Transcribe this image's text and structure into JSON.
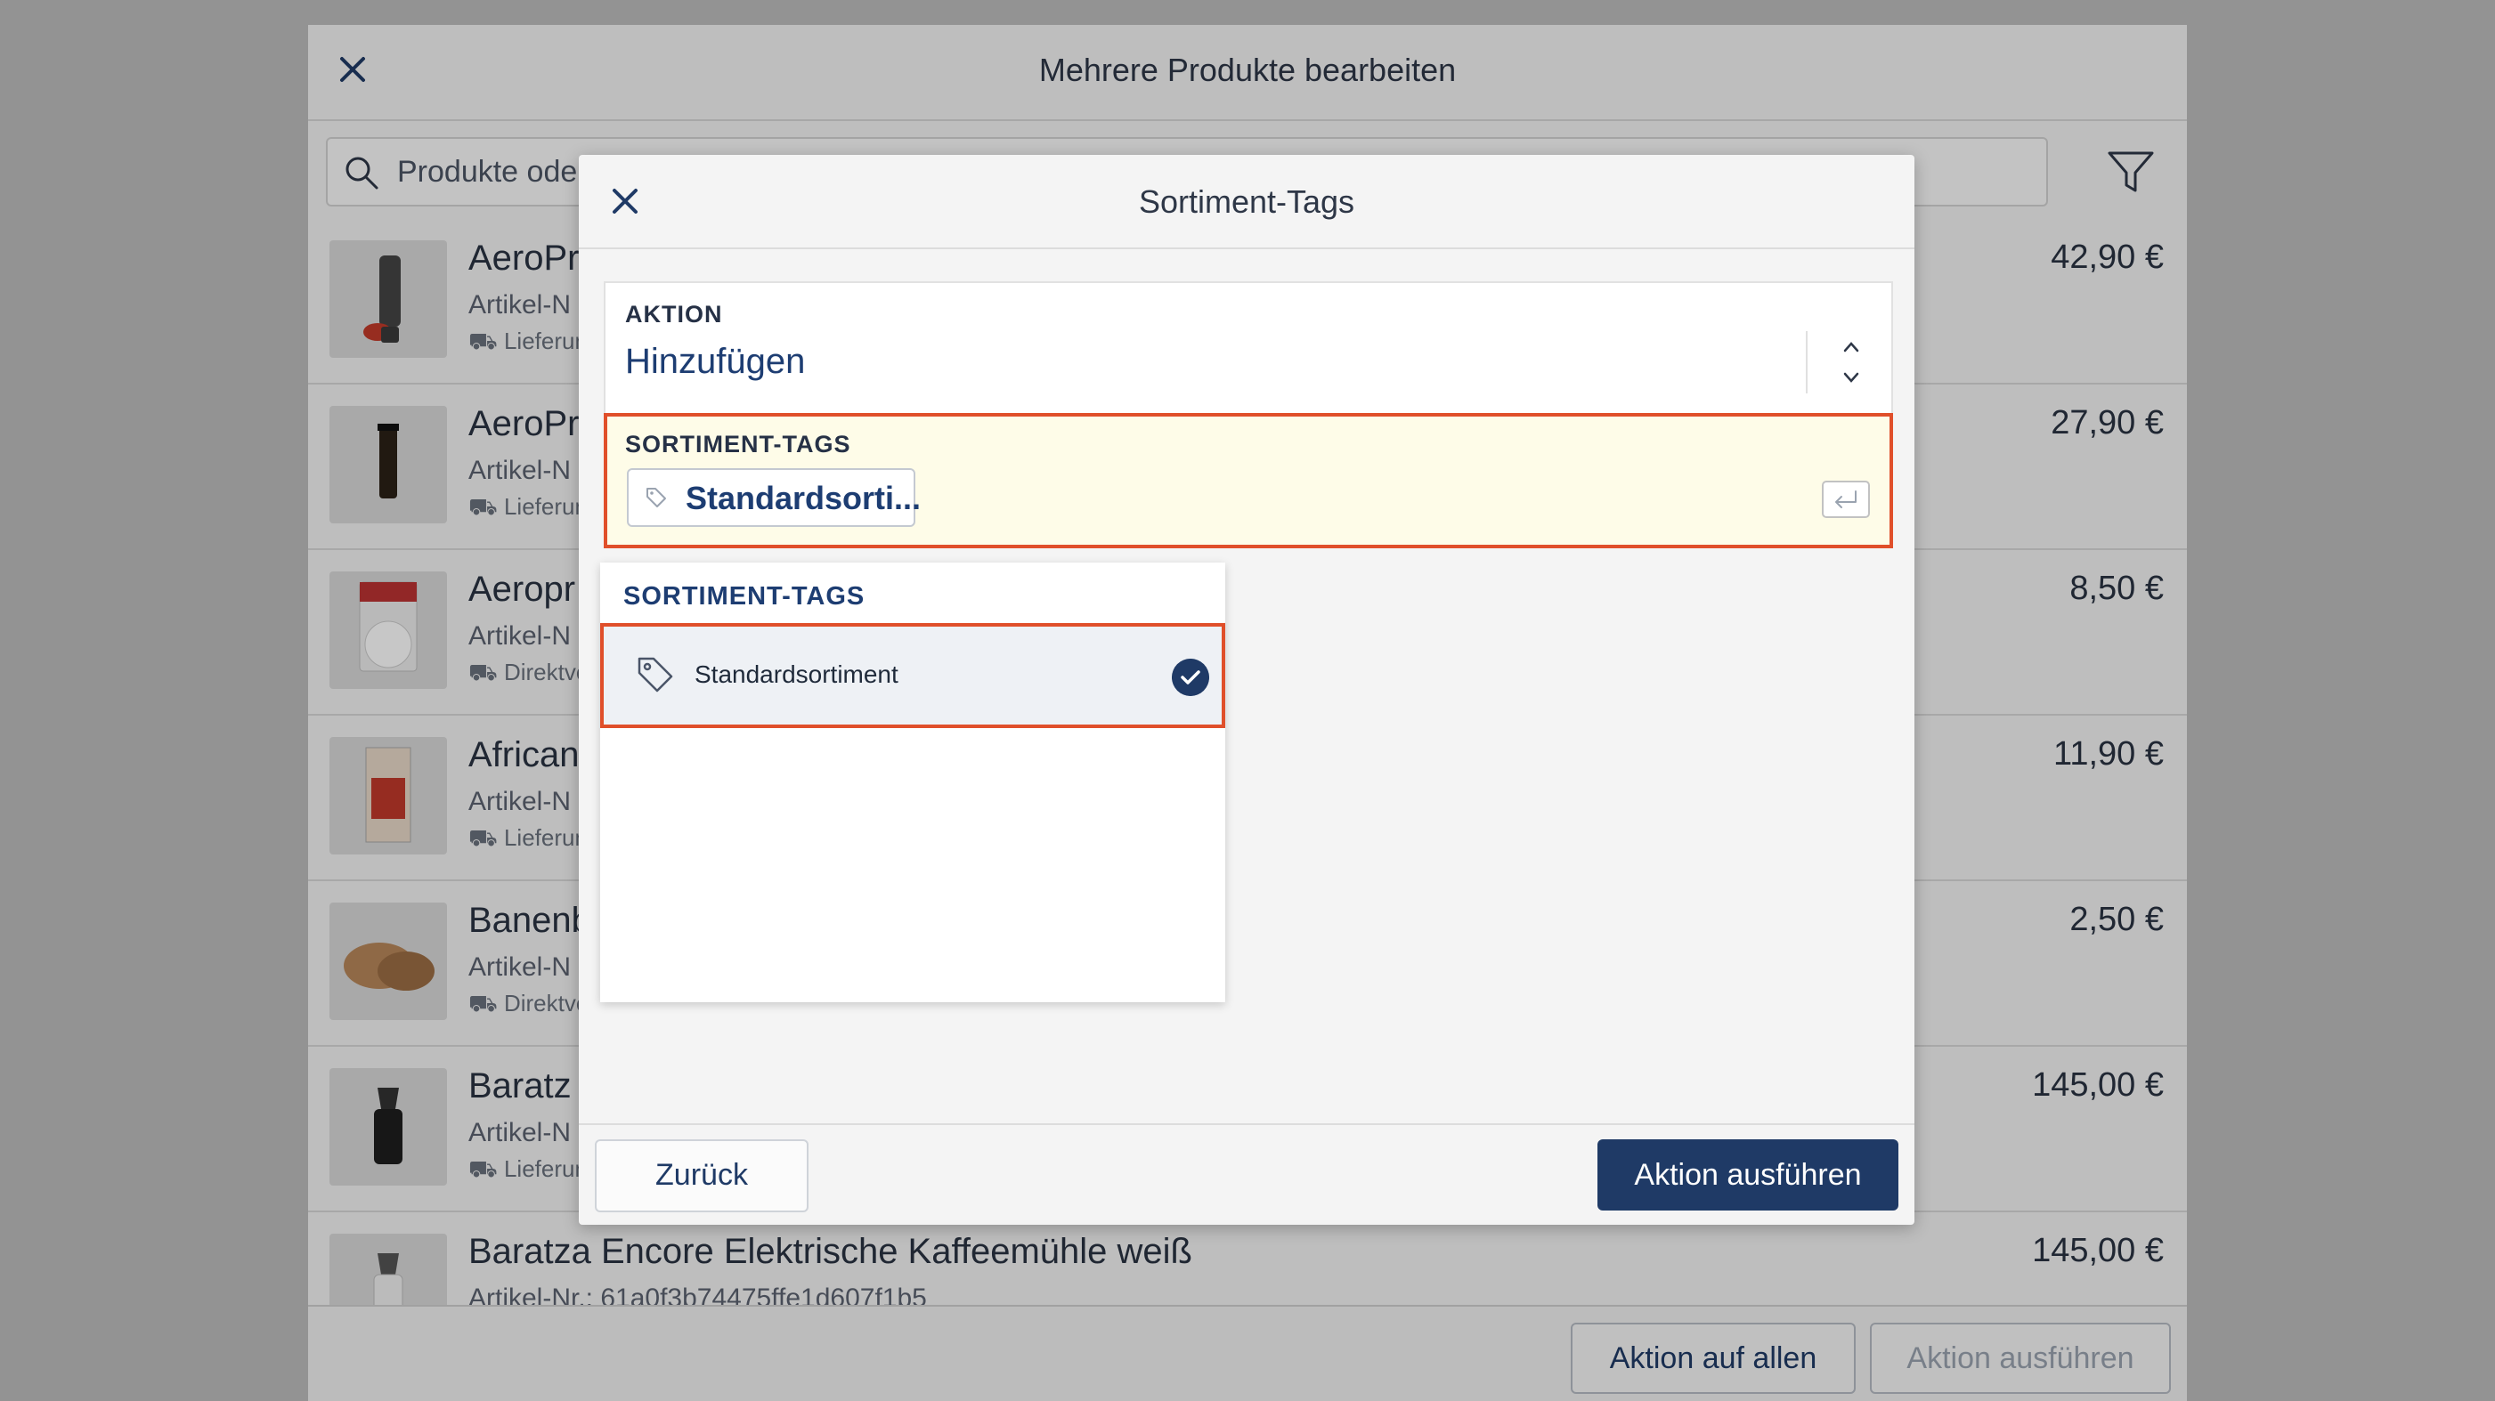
{
  "background": {
    "title": "Mehrere Produkte bearbeiten",
    "search_placeholder": "Produkte oder",
    "products": [
      {
        "name": "AeroPr",
        "sku": "Artikel-N",
        "meta": "Lieferun",
        "price": "42,90 €"
      },
      {
        "name": "AeroPr",
        "sku": "Artikel-N",
        "meta": "Lieferun",
        "price": "27,90 €"
      },
      {
        "name": "Aeropr",
        "sku": "Artikel-N",
        "meta": "Direktve",
        "price": "8,50 €"
      },
      {
        "name": "African",
        "sku": "Artikel-N",
        "meta": "Lieferun",
        "price": "11,90 €"
      },
      {
        "name": "Banenb",
        "sku": "Artikel-N",
        "meta": "Direktve",
        "price": "2,50 €"
      },
      {
        "name": "Baratz",
        "sku": "Artikel-N",
        "meta": "Lieferun",
        "price": "145,00 €"
      },
      {
        "name": "Baratza Encore Elektrische Kaffeemühle weiß",
        "sku": "Artikel-Nr.: 61a0f3b74475ffe1d607f1b5",
        "meta": "",
        "price": "145,00 €"
      }
    ],
    "action_all_label": "Aktion auf allen",
    "action_run_label": "Aktion ausführen"
  },
  "modal": {
    "title": "Sortiment-Tags",
    "action_label": "AKTION",
    "action_value": "Hinzufügen",
    "tags_label": "SORTIMENT-TAGS",
    "chip_label": "Standardsorti...",
    "dropdown_header": "SORTIMENT-TAGS",
    "dropdown_items": [
      {
        "label": "Standardsortiment",
        "selected": true
      }
    ],
    "back_label": "Zurück",
    "submit_label": "Aktion ausführen"
  },
  "colors": {
    "primary": "#1f3a66",
    "highlight_border": "#e04f2a",
    "tags_field_bg": "#fefce8"
  }
}
